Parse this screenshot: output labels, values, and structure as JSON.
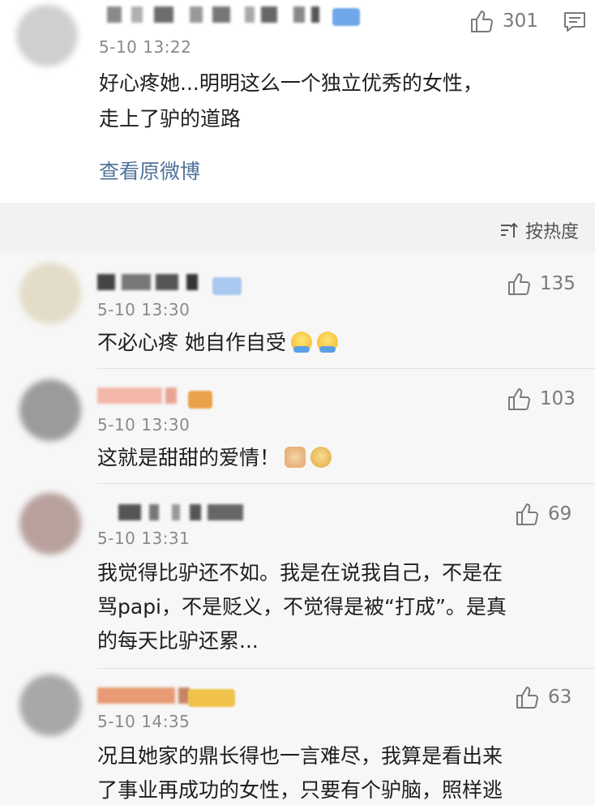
{
  "top_comment": {
    "time": "5-10 13:22",
    "text_line1": "好心疼她...明明这么一个独立优秀的女性，",
    "text_line2": "走上了驴的道路",
    "likes": "301",
    "view_original": "查看原微博"
  },
  "sort_label": "按热度",
  "comments": [
    {
      "time": "5-10 13:30",
      "text": "不必心疼 她自作自受",
      "likes": "135",
      "emoji": [
        "face-with-hands-emoji",
        "face-with-hands-emoji"
      ]
    },
    {
      "time": "5-10 13:30",
      "text": "这就是甜甜的爱情！",
      "likes": "103",
      "emoji": [
        "thumbs-up-emoji",
        "doge-emoji"
      ]
    },
    {
      "time": "5-10 13:31",
      "lines": [
        "我觉得比驴还不如。我是在说我自己，不是在",
        "骂papi，不是贬义，不觉得是被“打成”。是真",
        "的每天比驴还累..."
      ],
      "likes": "69"
    },
    {
      "time": "5-10 14:35",
      "lines": [
        "况且她家的鼎长得也一言难尽，我算是看出来",
        "了事业再成功的女性，只要有个驴脑，照样逃"
      ],
      "likes": "63"
    }
  ],
  "colors": {
    "link": "#51739a",
    "time": "#8a8a8a",
    "background": "#f2f2f2"
  }
}
